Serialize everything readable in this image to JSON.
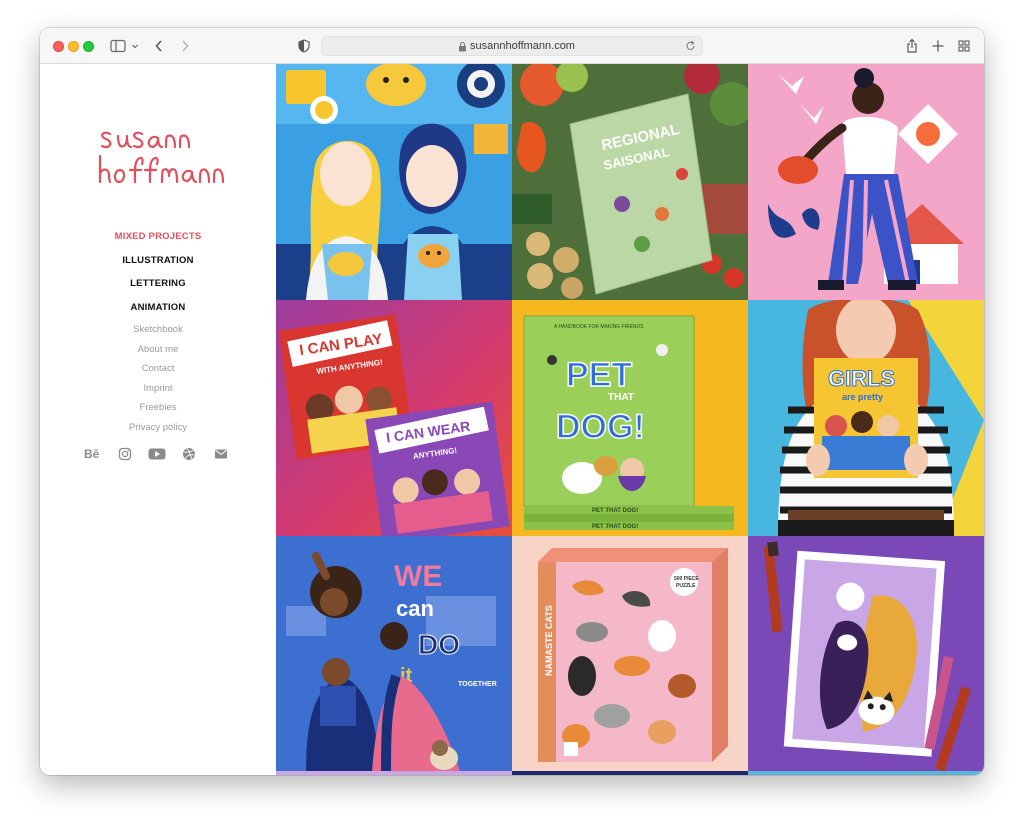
{
  "browser": {
    "url": "susannhoffmann.com",
    "icons": [
      "sidebar-toggle-icon",
      "chevron-down-icon",
      "back-arrow-icon",
      "forward-arrow-icon",
      "privacy-shield-icon",
      "lock-icon",
      "reload-icon",
      "share-icon",
      "new-tab-icon",
      "tab-overview-icon"
    ]
  },
  "site": {
    "logo_text": "susann hoffmann",
    "brand_color": "#e0505c",
    "nav_main": [
      {
        "label": "MIXED PROJECTS",
        "active": true
      },
      {
        "label": "ILLUSTRATION",
        "active": false
      },
      {
        "label": "LETTERING",
        "active": false
      },
      {
        "label": "ANIMATION",
        "active": false
      }
    ],
    "nav_secondary": [
      "Sketchbook",
      "About me",
      "Contact",
      "Imprint",
      "Freebies",
      "Privacy policy"
    ],
    "social_icons": [
      "behance-icon",
      "instagram-icon",
      "youtube-icon",
      "dribbble-icon",
      "mail-icon"
    ],
    "behance_glyph": "Bē"
  },
  "portfolio": {
    "tiles": [
      {
        "name": "guinea-pig-shop-illustration",
        "bg": "#3a9fe3",
        "texts": []
      },
      {
        "name": "regional-seasonal-vegetables",
        "bg": "#4e6f3a",
        "texts": [
          "REGIONAL",
          "SAISONAL"
        ]
      },
      {
        "name": "woman-walking-flowers",
        "bg": "#f4a6c8",
        "texts": []
      },
      {
        "name": "i-can-play-books",
        "bg": "#d84a6a",
        "texts": [
          "I CAN PLAY",
          "WITH ANYTHING!",
          "I CAN WEAR",
          "ANYTHING!"
        ]
      },
      {
        "name": "pet-that-dog-book",
        "bg": "#f5b81f",
        "texts": [
          "PET",
          "THAT",
          "DOG!",
          "PET THAT DOG!"
        ]
      },
      {
        "name": "girls-are-pretty-book",
        "bg": "#48b7e0",
        "texts": [
          "GIRLS",
          "are pretty"
        ]
      },
      {
        "name": "we-can-do-it-together",
        "bg": "#3c6fd0",
        "texts": [
          "WE",
          "can",
          "DO",
          "it",
          "TOGETHER"
        ]
      },
      {
        "name": "namaste-cats-puzzle",
        "bg": "#f7d4c6",
        "texts": [
          "NAMASTE CATS",
          "500 PIECE PUZZLE"
        ]
      },
      {
        "name": "dog-print-with-markers",
        "bg": "#7b48b8",
        "texts": []
      }
    ]
  }
}
